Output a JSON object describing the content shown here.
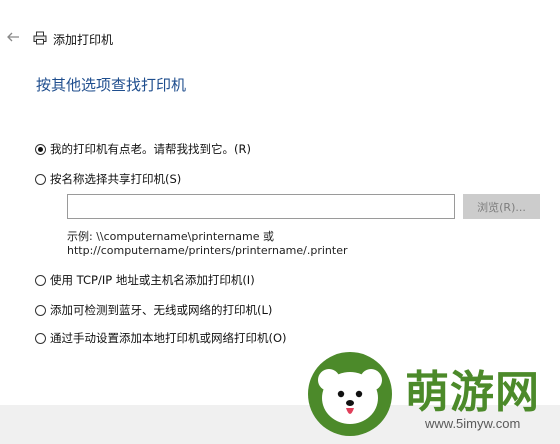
{
  "header": {
    "back_icon": "arrow-left-icon",
    "printer_icon": "printer-icon",
    "title": "添加打印机"
  },
  "heading": "按其他选项查找打印机",
  "options": [
    {
      "label": "我的打印机有点老。请帮我找到它。(R)",
      "checked": true
    },
    {
      "label": "按名称选择共享打印机(S)",
      "checked": false
    },
    {
      "label": "使用 TCP/IP 地址或主机名添加打印机(I)",
      "checked": false
    },
    {
      "label": "添加可检测到蓝牙、无线或网络的打印机(L)",
      "checked": false
    },
    {
      "label": "通过手动设置添加本地打印机或网络打印机(O)",
      "checked": false
    }
  ],
  "share_input": {
    "value": "",
    "placeholder": ""
  },
  "browse_button": "浏览(R)...",
  "example": {
    "line1": "示例: \\\\computername\\printername 或",
    "line2": "http://computername/printers/printername/.printer"
  },
  "watermark": {
    "brand": "萌游网",
    "url": "www.5imyw.com"
  },
  "colors": {
    "heading": "#1f4e8e",
    "footer_bg": "#f0f0f0",
    "button_disabled_bg": "#cccccc",
    "watermark_green": "#4c8a2a"
  }
}
